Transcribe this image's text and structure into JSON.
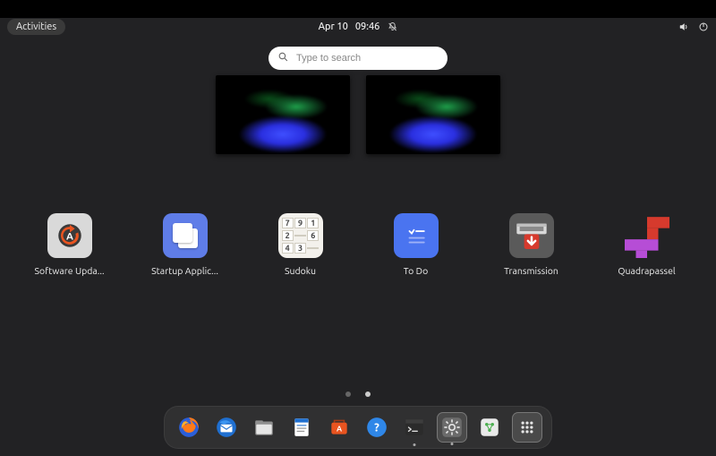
{
  "topbar": {
    "activities_label": "Activities",
    "date": "Apr 10",
    "time": "09:46"
  },
  "search": {
    "placeholder": "Type to search"
  },
  "workspaces": [
    {
      "name": "workspace-1"
    },
    {
      "name": "workspace-2"
    }
  ],
  "apps": [
    {
      "label": "Software Upda...",
      "name": "software-updater",
      "icon": "software-updater-icon"
    },
    {
      "label": "Startup Applic...",
      "name": "startup-applications",
      "icon": "startup-applications-icon"
    },
    {
      "label": "Sudoku",
      "name": "sudoku",
      "icon": "sudoku-icon"
    },
    {
      "label": "To Do",
      "name": "todo",
      "icon": "todo-icon"
    },
    {
      "label": "Transmission",
      "name": "transmission",
      "icon": "transmission-icon"
    },
    {
      "label": "Quadrapassel",
      "name": "quadrapassel",
      "icon": "quadrapassel-icon"
    }
  ],
  "pages": {
    "current": 2,
    "total": 2
  },
  "dock": [
    {
      "name": "firefox",
      "icon": "firefox-icon"
    },
    {
      "name": "thunderbird",
      "icon": "thunderbird-icon"
    },
    {
      "name": "files",
      "icon": "files-icon"
    },
    {
      "name": "libreoffice-writer",
      "icon": "writer-icon"
    },
    {
      "name": "ubuntu-software",
      "icon": "software-icon"
    },
    {
      "name": "help",
      "icon": "help-icon"
    },
    {
      "name": "terminal",
      "icon": "terminal-icon",
      "running": true
    },
    {
      "name": "settings",
      "icon": "gear-icon",
      "running": true,
      "highlighted": true
    },
    {
      "name": "trash",
      "icon": "trash-icon"
    },
    {
      "name": "show-applications",
      "icon": "grid-icon",
      "highlighted": true
    }
  ],
  "sudoku_digits": [
    "7",
    "9",
    "1",
    "2",
    "",
    "6",
    "4",
    "3",
    ""
  ]
}
